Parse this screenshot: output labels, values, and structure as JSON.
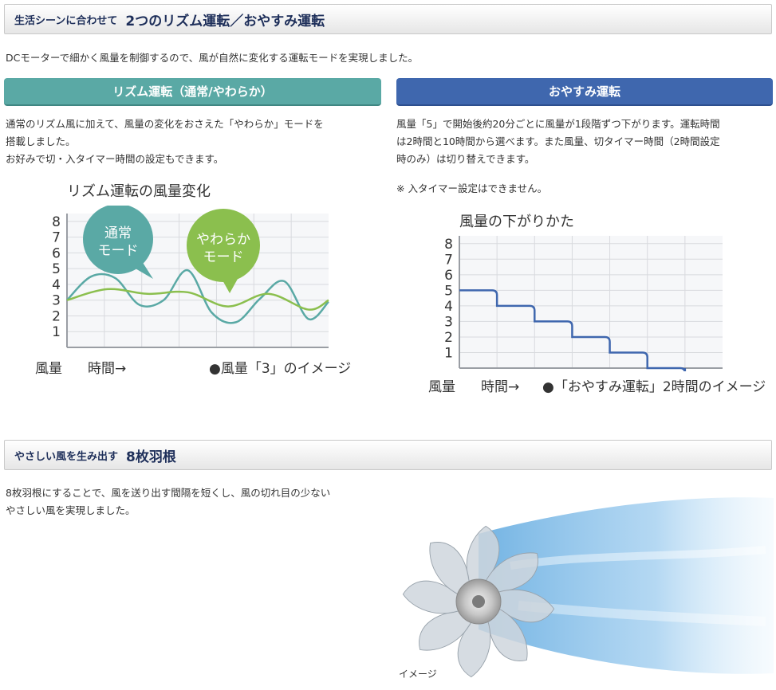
{
  "section1": {
    "small_title": "生活シーンに合わせて",
    "big_title": "2つのリズム運転／おやすみ運転",
    "intro": "DCモーターで細かく風量を制御するので、風が自然に変化する運転モードを実現しました。"
  },
  "rhythm": {
    "label": "リズム運転（通常/やわらか）",
    "text_line1": "通常のリズム風に加えて、風量の変化をおさえた「やわらか」モードを",
    "text_line2": "搭載しました。",
    "text_line3": "お好みで切・入タイマー時間の設定もできます。"
  },
  "sleep": {
    "label": "おやすみ運転",
    "text_line1": "風量「5」で開始後約20分ごとに風量が1段階ずつ下がります。運転時間",
    "text_line2": "は2時間と10時間から選べます。また風量、切タイマー時間（2時間設定",
    "text_line3": "時のみ）は切り替えできます。",
    "note": "※ 入タイマー設定はできません。"
  },
  "chart_data": [
    {
      "type": "line",
      "title": "リズム運転の風量変化",
      "xlabel": "時間→",
      "ylabel": "風量",
      "annotation": "●風量「3」のイメージ",
      "ylim": [
        1,
        8
      ],
      "yticks": [
        1,
        2,
        3,
        4,
        5,
        6,
        7,
        8
      ],
      "colors": {
        "normal": "#5aa9a5",
        "soft": "#8bbf4e"
      },
      "series": [
        {
          "name": "通常\nモード",
          "label_line1": "通常",
          "label_line2": "モード",
          "x": [
            0,
            1.2,
            2.4,
            3.6,
            4.8,
            6.0,
            7.2,
            8.4,
            9.6,
            10.8,
            12.0,
            13.0
          ],
          "values": [
            3.0,
            4.5,
            4.4,
            2.7,
            3.0,
            4.9,
            2.2,
            1.6,
            3.1,
            4.2,
            1.8,
            2.9
          ]
        },
        {
          "name": "やわらか\nモード",
          "label_line1": "やわらか",
          "label_line2": "モード",
          "x": [
            0,
            2.0,
            4.0,
            6.0,
            8.0,
            10.0,
            12.0,
            13.0
          ],
          "values": [
            3.0,
            3.7,
            3.4,
            3.5,
            2.6,
            3.4,
            2.4,
            3.0
          ]
        }
      ]
    },
    {
      "type": "line",
      "title": "風量の下がりかた",
      "xlabel": "時間→",
      "ylabel": "風量",
      "annotation": "●「おやすみ運転」2時間のイメージ",
      "ylim": [
        1,
        8
      ],
      "yticks": [
        1,
        2,
        3,
        4,
        5,
        6,
        7,
        8
      ],
      "colors": {
        "line": "#3f67ae"
      },
      "series": [
        {
          "x": [
            0,
            20,
            40,
            60,
            80,
            100,
            120
          ],
          "values": [
            5,
            4,
            3,
            2,
            1,
            0,
            0
          ]
        }
      ]
    }
  ],
  "section2": {
    "small_title": "やさしい風を生み出す",
    "big_title": "8枚羽根",
    "text_line1": "8枚羽根にすることで、風を送り出す間隔を短くし、風の切れ目の少ない",
    "text_line2": "やさしい風を実現しました。",
    "image_caption": "イメージ"
  }
}
